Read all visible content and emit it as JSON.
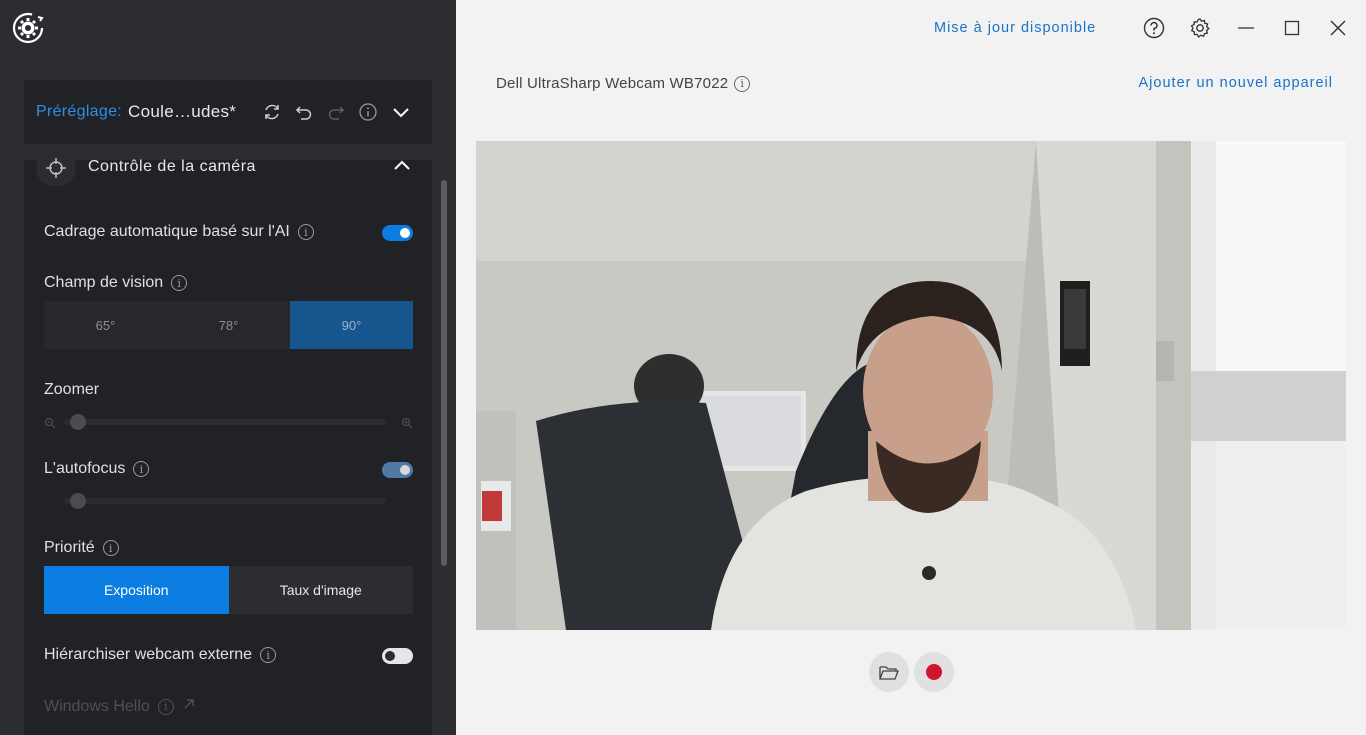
{
  "sidebar": {
    "preset": {
      "label": "Préréglage:",
      "value": "Coule…udes*"
    },
    "camera_control": {
      "title": "Contrôle de la caméra",
      "ai_framing": {
        "label": "Cadrage automatique basé sur l'AI",
        "enabled": true
      },
      "field_of_view": {
        "label": "Champ de vision",
        "options": [
          "65°",
          "78°",
          "90°"
        ],
        "selected": "90°"
      },
      "zoom": {
        "label": "Zoomer",
        "value": 0
      },
      "autofocus": {
        "label": "L'autofocus",
        "enabled": true,
        "value": 0
      },
      "priority": {
        "label": "Priorité",
        "options": [
          "Exposition",
          "Taux d'image"
        ],
        "selected": "Exposition"
      },
      "external_webcam": {
        "label": "Hiérarchiser webcam externe",
        "enabled": false
      },
      "windows_hello": {
        "label": "Windows Hello"
      }
    }
  },
  "header": {
    "update_link": "Mise à jour disponible",
    "icons": [
      "help-icon",
      "settings-icon",
      "minimize-icon",
      "maximize-icon",
      "close-icon"
    ]
  },
  "main": {
    "device_name": "Dell UltraSharp Webcam WB7022",
    "add_device": "Ajouter un nouvel appareil",
    "controls": [
      "open-folder-icon",
      "record-icon"
    ]
  },
  "colors": {
    "accent": "#0c7de0",
    "link": "#1a73c9",
    "sidebar_bg": "#2b2d31",
    "record": "#d0142c"
  }
}
